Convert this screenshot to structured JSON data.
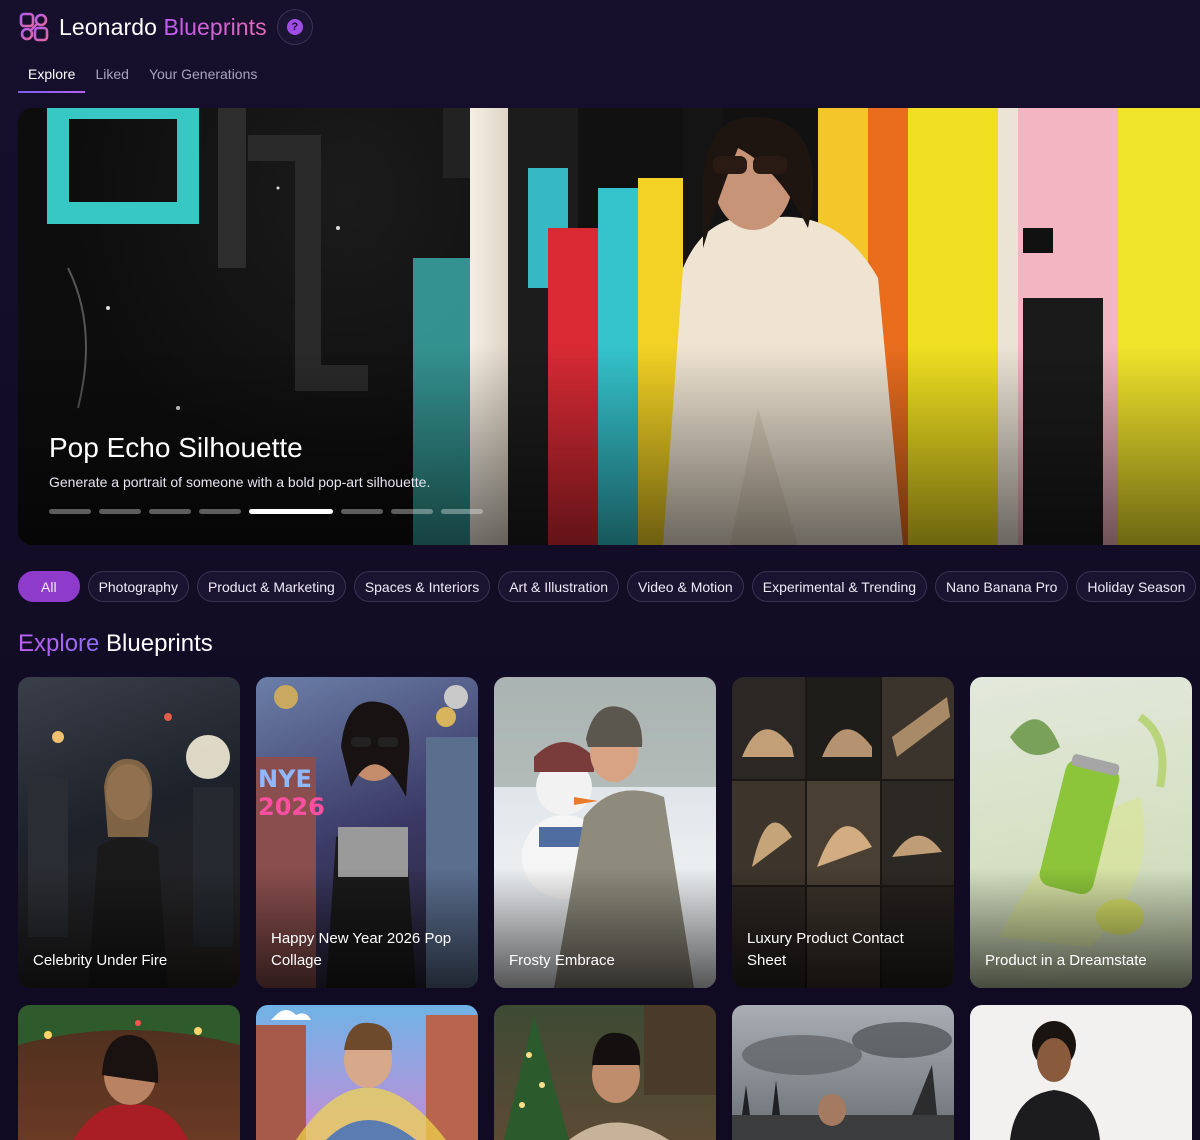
{
  "app": {
    "brand_prefix": "Leonardo",
    "brand_highlight": "Blueprints",
    "help_glyph": "?"
  },
  "tabs": [
    {
      "label": "Explore",
      "active": true
    },
    {
      "label": "Liked",
      "active": false
    },
    {
      "label": "Your Generations",
      "active": false
    }
  ],
  "hero": {
    "title": "Pop Echo Silhouette",
    "description": "Generate a portrait of someone with a bold pop-art silhouette.",
    "slide_count": 8,
    "active_slide": 5
  },
  "categories": [
    {
      "label": "All",
      "active": true
    },
    {
      "label": "Photography",
      "active": false
    },
    {
      "label": "Product & Marketing",
      "active": false
    },
    {
      "label": "Spaces & Interiors",
      "active": false
    },
    {
      "label": "Art & Illustration",
      "active": false
    },
    {
      "label": "Video & Motion",
      "active": false
    },
    {
      "label": "Experimental & Trending",
      "active": false
    },
    {
      "label": "Nano Banana Pro",
      "active": false
    },
    {
      "label": "Holiday Season",
      "active": false
    }
  ],
  "section": {
    "title_highlight": "Explore",
    "title_rest": "Blueprints"
  },
  "cards_row1": [
    {
      "label": "Celebrity Under Fire"
    },
    {
      "label": "Happy New Year 2026 Pop Collage"
    },
    {
      "label": "Frosty Embrace"
    },
    {
      "label": "Luxury Product Contact Sheet"
    },
    {
      "label": "Product in a Dreamstate"
    }
  ],
  "cards_row2": [
    {
      "label": ""
    },
    {
      "label": ""
    },
    {
      "label": ""
    },
    {
      "label": ""
    },
    {
      "label": ""
    }
  ],
  "colors": {
    "background": "#110c24",
    "accent_purple": "#8e3bcc",
    "brand_gradient_start": "#c35cf5",
    "brand_gradient_end": "#e66ab7"
  },
  "icons": {
    "logo": "leonardo-blueprint-icon",
    "help": "question-icon"
  }
}
